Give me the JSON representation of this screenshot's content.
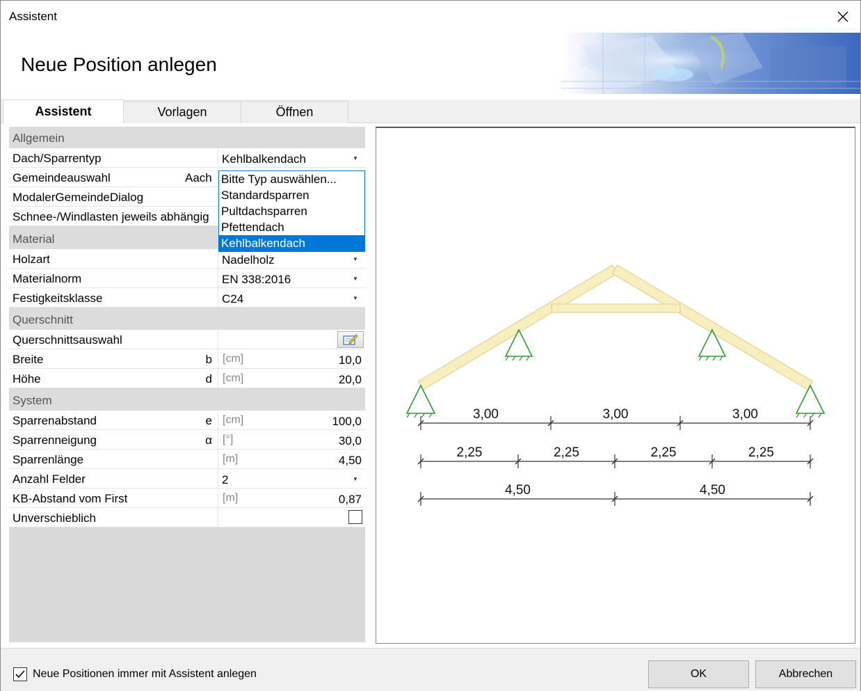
{
  "window": {
    "title": "Assistent"
  },
  "header": {
    "title": "Neue Position anlegen"
  },
  "tabs": [
    {
      "label": "Assistent"
    },
    {
      "label": "Vorlagen"
    },
    {
      "label": "Öffnen"
    }
  ],
  "grid": {
    "categories": {
      "allgemein": "Allgemein",
      "material": "Material",
      "querschnitt": "Querschnitt",
      "system": "System"
    },
    "rows": {
      "dachtyp": {
        "label": "Dach/Sparrentyp",
        "value": "Kehlbalkendach"
      },
      "gemeinde": {
        "label": "Gemeindeauswahl",
        "value": "Aach"
      },
      "modaler": {
        "label": "ModalerGemeindeDialog"
      },
      "schnee": {
        "label": "Schnee-/Windlasten jeweils abhängig"
      },
      "holzart": {
        "label": "Holzart",
        "value": "Nadelholz"
      },
      "materialnorm": {
        "label": "Materialnorm",
        "value": "EN 338:2016"
      },
      "festigkeit": {
        "label": "Festigkeitsklasse",
        "value": "C24"
      },
      "qsauswahl": {
        "label": "Querschnittsauswahl"
      },
      "breite": {
        "label": "Breite",
        "symbol": "b",
        "unit": "[cm]",
        "value": "10,0"
      },
      "hoehe": {
        "label": "Höhe",
        "symbol": "d",
        "unit": "[cm]",
        "value": "20,0"
      },
      "abstand": {
        "label": "Sparrenabstand",
        "symbol": "e",
        "unit": "[cm]",
        "value": "100,0"
      },
      "neigung": {
        "label": "Sparrenneigung",
        "symbol": "α",
        "unit": "[°]",
        "value": "30,0"
      },
      "laenge": {
        "label": "Sparrenlänge",
        "unit": "[m]",
        "value": "4,50"
      },
      "felder": {
        "label": "Anzahl Felder",
        "value": "2"
      },
      "kbabstand": {
        "label": "KB-Abstand vom First",
        "unit": "[m]",
        "value": "0,87"
      },
      "unverschieblich": {
        "label": "Unverschieblich",
        "checked": false
      }
    }
  },
  "dropdown": {
    "options": [
      "Bitte Typ auswählen...",
      "Standardsparren",
      "Pultdachsparren",
      "Pfettendach",
      "Kehlbalkendach"
    ],
    "selected": "Kehlbalkendach"
  },
  "drawing": {
    "dim_row1": [
      "3,00",
      "3,00",
      "3,00"
    ],
    "dim_row2": [
      "2,25",
      "2,25",
      "2,25",
      "2,25"
    ],
    "dim_row3": [
      "4,50",
      "4,50"
    ],
    "colors": {
      "beam": "#f7efc0",
      "beam_stroke": "#e0cd7a",
      "support": "#2f9a2f",
      "dimension": "#333333"
    }
  },
  "footer": {
    "checkbox_label": "Neue Positionen immer mit Assistent anlegen",
    "checkbox_checked": true,
    "ok_label": "OK",
    "cancel_label": "Abbrechen"
  }
}
